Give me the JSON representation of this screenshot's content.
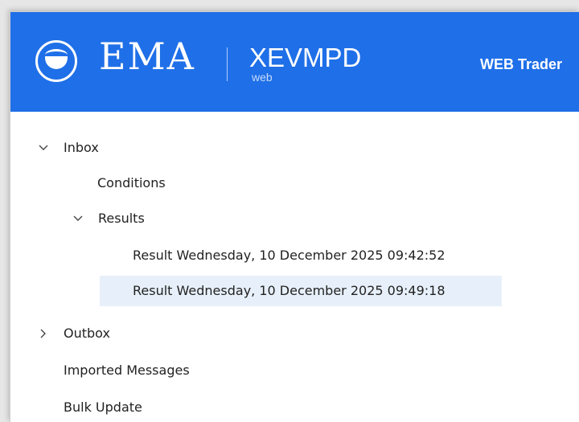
{
  "header": {
    "brand_name": "EMA",
    "product_name": "XEVMPD",
    "product_sub": "web",
    "app_link": "WEB Trader",
    "background_color": "#1f6fe8"
  },
  "tree": {
    "inbox": {
      "label": "Inbox",
      "expanded": true,
      "children": {
        "conditions": {
          "label": "Conditions"
        },
        "results": {
          "label": "Results",
          "expanded": true,
          "items": [
            {
              "label": "Result Wednesday, 10 December 2025 09:42:52",
              "selected": false
            },
            {
              "label": "Result Wednesday, 10 December 2025 09:49:18",
              "selected": true
            }
          ]
        }
      }
    },
    "outbox": {
      "label": "Outbox",
      "expanded": false
    },
    "imported_messages": {
      "label": "Imported Messages"
    },
    "bulk_update": {
      "label": "Bulk Update"
    },
    "selected_color": "#e7f0fa"
  }
}
